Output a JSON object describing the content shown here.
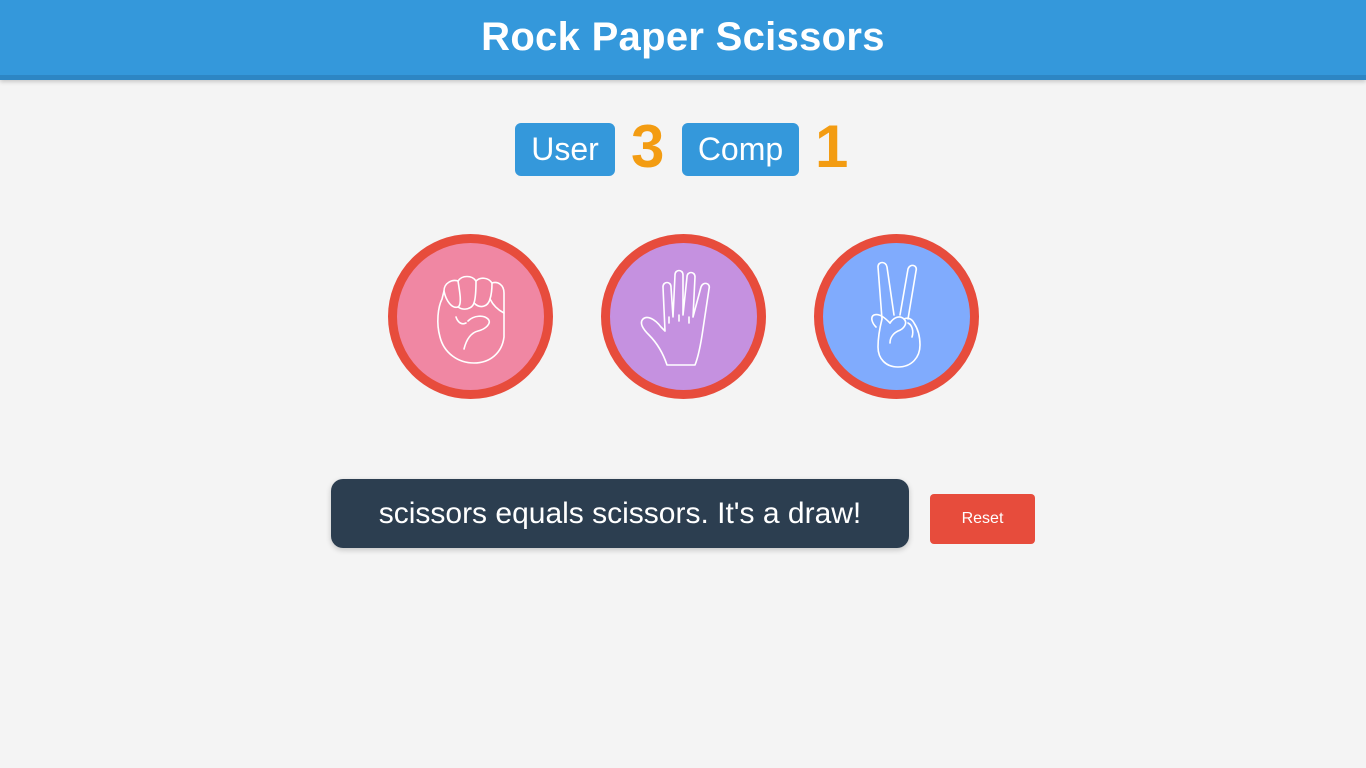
{
  "header": {
    "title": "Rock Paper Scissors"
  },
  "scoreboard": {
    "user_label": "User",
    "user_score": "3",
    "comp_label": "Comp",
    "comp_score": "1"
  },
  "choices": [
    {
      "id": "rock",
      "icon": "rock-fist-icon",
      "color": "#f087a3"
    },
    {
      "id": "paper",
      "icon": "paper-hand-icon",
      "color": "#c591e0"
    },
    {
      "id": "scissors",
      "icon": "scissors-hand-icon",
      "color": "#80abfd"
    }
  ],
  "result": {
    "message": "scissors equals scissors. It's a draw!"
  },
  "controls": {
    "reset_label": "Reset"
  },
  "colors": {
    "header": "#3498db",
    "badge": "#3498db",
    "score": "#f39c12",
    "choice_border": "#e74c3c",
    "message_bg": "#2c3e50",
    "reset": "#e74c3c"
  }
}
